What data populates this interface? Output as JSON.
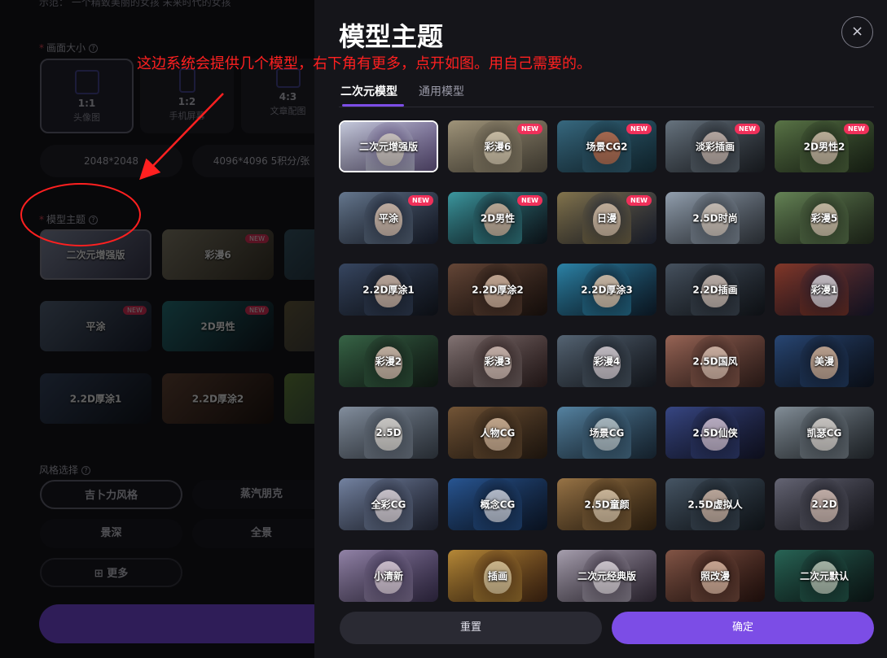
{
  "left": {
    "prompt_example": "示范：  一个精致美丽的女孩  未来时代的女孩",
    "size_section_label": "画面大小",
    "sizes": [
      {
        "ratio": "1:1",
        "sub": "头像图"
      },
      {
        "ratio": "1:2",
        "sub": "手机屏幕"
      },
      {
        "ratio": "4:3",
        "sub": "文章配图"
      }
    ],
    "resolutions": [
      "2048*2048",
      "4096*4096  5积分/张"
    ],
    "model_section_label": "模型主题",
    "models": [
      {
        "label": "二次元增强版",
        "new": ""
      },
      {
        "label": "彩漫6",
        "new": "NEW"
      },
      {
        "label": "平涂",
        "new": "NEW"
      },
      {
        "label": "2D男性",
        "new": "NEW"
      },
      {
        "label": "2.2D厚涂1",
        "new": ""
      },
      {
        "label": "2.2D厚涂2",
        "new": ""
      }
    ],
    "style_section_label": "风格选择",
    "styles": [
      "吉卜力风格",
      "蒸汽朋克",
      "景深",
      "全景"
    ],
    "more_label": "更多"
  },
  "annotation": {
    "text": "这边系统会提供几个模型，右下角有更多，点开如图。用自己需要的。",
    "color": "#ff2020"
  },
  "panel": {
    "title": "模型主题",
    "close_glyph": "×",
    "tabs": [
      "二次元模型",
      "通用模型"
    ],
    "models": [
      {
        "label": "二次元增强版",
        "new": "",
        "colors": [
          "#cfd4e6",
          "#6b5b8c",
          "#e8e0d8"
        ]
      },
      {
        "label": "彩漫6",
        "new": "NEW",
        "colors": [
          "#a89c80",
          "#5b5446",
          "#e9dcc0"
        ]
      },
      {
        "label": "场景CG2",
        "new": "NEW",
        "colors": [
          "#3a6e86",
          "#16323e",
          "#c87a5a"
        ]
      },
      {
        "label": "淡彩插画",
        "new": "NEW",
        "colors": [
          "#6d7a86",
          "#20242a",
          "#d8c8c0"
        ]
      },
      {
        "label": "2D男性2",
        "new": "NEW",
        "colors": [
          "#5e7a4a",
          "#1e2a1a",
          "#e0cfb8"
        ]
      },
      {
        "label": "平涂",
        "new": "NEW",
        "colors": [
          "#6b7e96",
          "#1a2030",
          "#e8d0c0"
        ]
      },
      {
        "label": "2D男性",
        "new": "NEW",
        "colors": [
          "#3fa0a8",
          "#101820",
          "#e0c8b0"
        ]
      },
      {
        "label": "日漫",
        "new": "NEW",
        "colors": [
          "#8a7a50",
          "#22283a",
          "#e8d0b8"
        ]
      },
      {
        "label": "2.5D时尚",
        "new": "",
        "colors": [
          "#9aa8b8",
          "#3a4048",
          "#e8dcd0"
        ]
      },
      {
        "label": "彩漫5",
        "new": "",
        "colors": [
          "#6a8a5a",
          "#263020",
          "#e8d8c0"
        ]
      },
      {
        "label": "2.2D厚涂1",
        "new": "",
        "colors": [
          "#3a4a66",
          "#12161e",
          "#e0c8b8"
        ]
      },
      {
        "label": "2.2D厚涂2",
        "new": "",
        "colors": [
          "#6a4a3a",
          "#1e1410",
          "#e8c8b0"
        ]
      },
      {
        "label": "2.2D厚涂3",
        "new": "",
        "colors": [
          "#2e8ab0",
          "#102030",
          "#f0d8c0"
        ]
      },
      {
        "label": "2.2D插画",
        "new": "",
        "colors": [
          "#4a5664",
          "#14181e",
          "#e0d0c8"
        ]
      },
      {
        "label": "彩漫1",
        "new": "",
        "colors": [
          "#8a3a2a",
          "#1a1a30",
          "#e8e0e8"
        ]
      },
      {
        "label": "彩漫2",
        "new": "",
        "colors": [
          "#3a6a4a",
          "#141e18",
          "#e8d0c0"
        ]
      },
      {
        "label": "彩漫3",
        "new": "",
        "colors": [
          "#8a7a7a",
          "#302020",
          "#e8d0c8"
        ]
      },
      {
        "label": "彩漫4",
        "new": "",
        "colors": [
          "#5a6a7a",
          "#1a1e26",
          "#e8e0e8"
        ]
      },
      {
        "label": "2.5D国风",
        "new": "",
        "colors": [
          "#a06a5a",
          "#3a2420",
          "#f0d0c0"
        ]
      },
      {
        "label": "美漫",
        "new": "",
        "colors": [
          "#2a4a7a",
          "#0e1420",
          "#e0c0a8"
        ]
      },
      {
        "label": "2.5D",
        "new": "",
        "colors": [
          "#8a96a6",
          "#3a424c",
          "#f0ece8"
        ]
      },
      {
        "label": "人物CG",
        "new": "",
        "colors": [
          "#7a5a3a",
          "#2a1e14",
          "#e8c8a8"
        ]
      },
      {
        "label": "场景CG",
        "new": "",
        "colors": [
          "#5a8aaa",
          "#1e3040",
          "#c8d8e0"
        ]
      },
      {
        "label": "2.5D仙侠",
        "new": "",
        "colors": [
          "#3a4a8a",
          "#14162a",
          "#e0d0e8"
        ]
      },
      {
        "label": "凯瑟CG",
        "new": "",
        "colors": [
          "#8a96a0",
          "#2a3036",
          "#eeeae6"
        ]
      },
      {
        "label": "全彩CG",
        "new": "",
        "colors": [
          "#7a8aaa",
          "#262a3a",
          "#f0e8f0"
        ]
      },
      {
        "label": "概念CG",
        "new": "",
        "colors": [
          "#2a5a9a",
          "#0e1a2e",
          "#d8e0f0"
        ]
      },
      {
        "label": "2.5D童颜",
        "new": "",
        "colors": [
          "#a07a4a",
          "#3a2814",
          "#f0d8b8"
        ]
      },
      {
        "label": "2.5D虚拟人",
        "new": "",
        "colors": [
          "#4a5a6a",
          "#141a20",
          "#e0c8b8"
        ]
      },
      {
        "label": "2.2D",
        "new": "",
        "colors": [
          "#6a6a7a",
          "#1e1e26",
          "#e8d0c8"
        ]
      },
      {
        "label": "小清新",
        "new": "",
        "colors": [
          "#9a8ab0",
          "#3a3050",
          "#f0e0f0"
        ]
      },
      {
        "label": "插画",
        "new": "",
        "colors": [
          "#c0903a",
          "#4a2a14",
          "#f0d8a8"
        ]
      },
      {
        "label": "二次元经典版",
        "new": "",
        "colors": [
          "#b0a8b8",
          "#3a3040",
          "#f0e8f0"
        ]
      },
      {
        "label": "照改漫",
        "new": "",
        "colors": [
          "#8a5a4a",
          "#2a1410",
          "#f0c8b0"
        ]
      },
      {
        "label": "二次元默认",
        "new": "",
        "colors": [
          "#2a6a5a",
          "#0e1a1a",
          "#c8d8c8"
        ]
      }
    ],
    "reset_label": "重置",
    "confirm_label": "确定",
    "accent_color": "#7c4de6"
  }
}
